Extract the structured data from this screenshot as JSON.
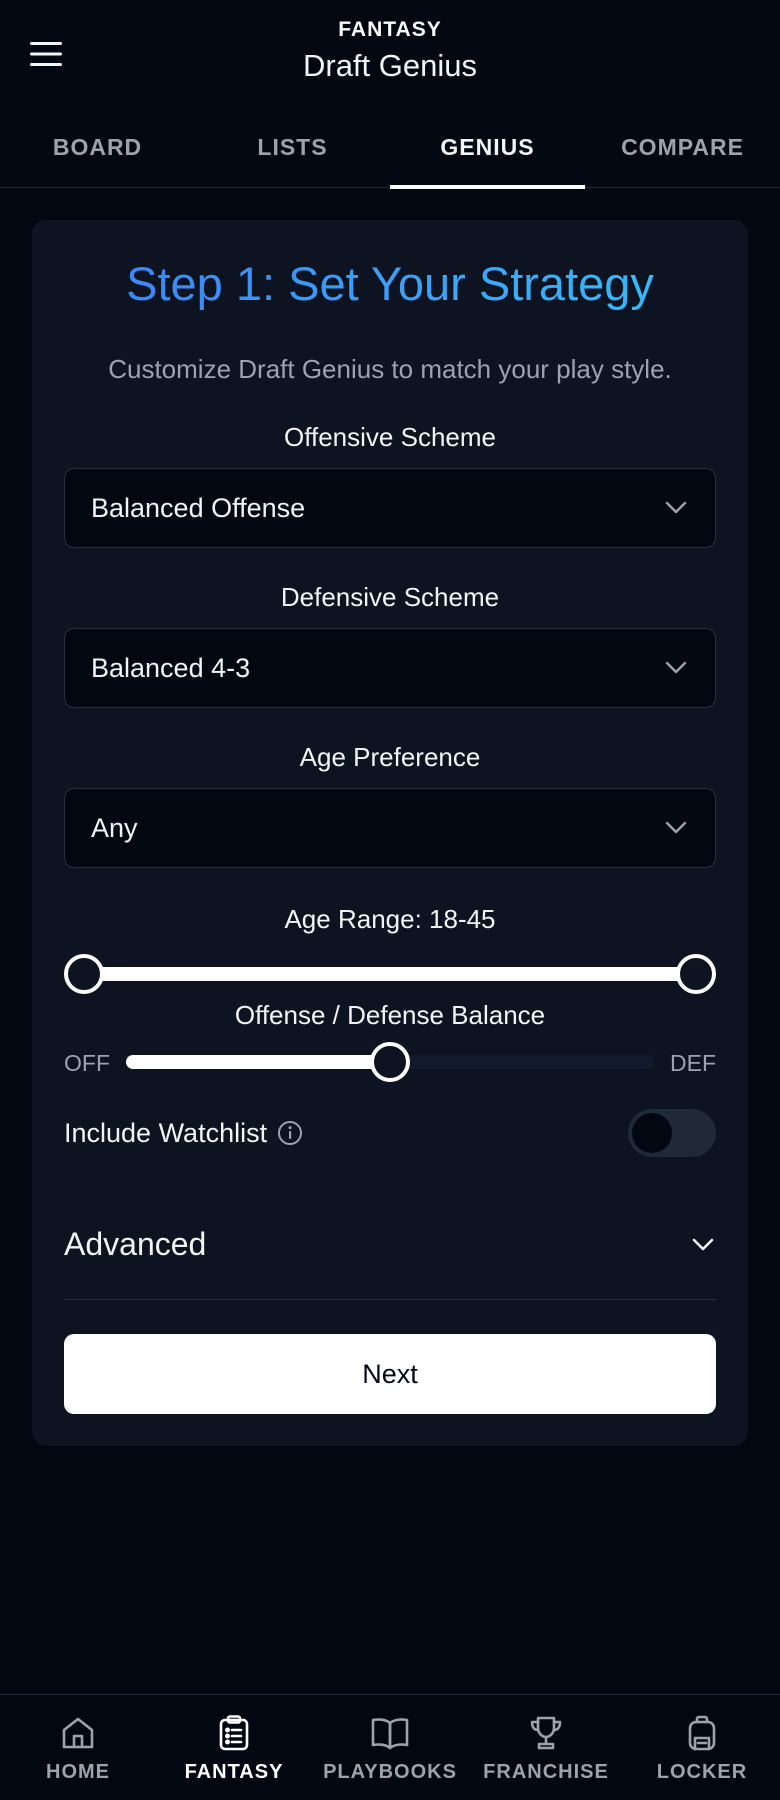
{
  "header": {
    "super_title": "FANTASY",
    "title": "Draft Genius"
  },
  "tabs": [
    {
      "label": "BOARD",
      "active": false
    },
    {
      "label": "LISTS",
      "active": false
    },
    {
      "label": "GENIUS",
      "active": true
    },
    {
      "label": "COMPARE",
      "active": false
    }
  ],
  "card": {
    "title": "Step 1: Set Your Strategy",
    "subtitle": "Customize Draft Genius to match your play style.",
    "offensive": {
      "label": "Offensive Scheme",
      "value": "Balanced Offense"
    },
    "defensive": {
      "label": "Defensive Scheme",
      "value": "Balanced 4-3"
    },
    "age_pref": {
      "label": "Age Preference",
      "value": "Any"
    },
    "age_range": {
      "label": "Age Range: 18-45",
      "min": 18,
      "max": 45,
      "low": 18,
      "high": 45
    },
    "balance": {
      "label": "Offense / Defense Balance",
      "off_label": "OFF",
      "def_label": "DEF",
      "value_percent": 50
    },
    "watchlist": {
      "label": "Include Watchlist",
      "enabled": false
    },
    "advanced_label": "Advanced",
    "next_label": "Next"
  },
  "bottom_nav": [
    {
      "label": "HOME",
      "icon": "home-icon",
      "active": false
    },
    {
      "label": "FANTASY",
      "icon": "clipboard-icon",
      "active": true
    },
    {
      "label": "PLAYBOOKS",
      "icon": "book-icon",
      "active": false
    },
    {
      "label": "FRANCHISE",
      "icon": "trophy-icon",
      "active": false
    },
    {
      "label": "LOCKER",
      "icon": "backpack-icon",
      "active": false
    }
  ],
  "colors": {
    "background": "#030712",
    "card": "#0d1320",
    "accent_start": "#3b82f6",
    "accent_end": "#38bdf8",
    "muted": "#9ca3af"
  }
}
